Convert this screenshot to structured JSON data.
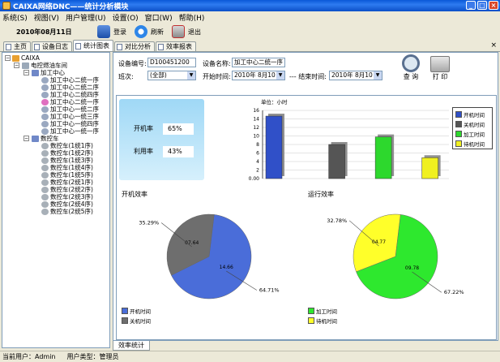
{
  "window": {
    "title": "CAIXA网络DNC——统计分析模块"
  },
  "menu": [
    "系统(S)",
    "视图(V)",
    "用户管理(U)",
    "设置(O)",
    "窗口(W)",
    "帮助(H)"
  ],
  "toolbar": {
    "date": "2010年08月11日",
    "login": "登录",
    "refresh": "刷新",
    "exit": "退出"
  },
  "tabs": [
    "主页",
    "设备日志",
    "统计图表",
    "对比分析",
    "效率报表"
  ],
  "tree": {
    "root": "CAIXA",
    "workshop": "电控燃油车间",
    "groups": [
      {
        "label": "加工中心",
        "items": [
          "加工中心二统一序",
          "加工中心二统二序",
          "加工中心二统四序",
          "加工中心二统一序",
          "加工中心一统二序",
          "加工中心一统三序",
          "加工中心一统四序",
          "加工中心一统一序"
        ]
      },
      {
        "label": "数控车",
        "items": [
          "数控车(1统1序)",
          "数控车(1统2序)",
          "数控车(1统3序)",
          "数控车(1统4序)",
          "数控车(1统5序)",
          "数控车(2统1序)",
          "数控车(2统2序)",
          "数控车(2统3序)",
          "数控车(2统4序)",
          "数控车(2统5序)"
        ]
      }
    ]
  },
  "form": {
    "device_no_label": "设备编号:",
    "device_no": "D100451200",
    "device_name_label": "设备名称:",
    "device_name": "加工中心二统一序",
    "shift_label": "班次:",
    "shift": "(全部)",
    "start_label": "开始时间:",
    "start": "2010年 8月10日",
    "end_label": "--- 结束时间:",
    "end": "2010年 8月10日",
    "query": "查 询",
    "print": "打 印"
  },
  "kpi": {
    "run_rate_label": "开机率",
    "run_rate": "65%",
    "use_rate_label": "利用率",
    "use_rate": "43%"
  },
  "bottom_tab": "效率统计",
  "status": {
    "user_label": "当前用户：",
    "user": "Admin",
    "type_label": "用户类型：",
    "type": "管理员"
  },
  "chart_data": [
    {
      "type": "bar",
      "title": "",
      "ylabel": "单位：小时",
      "ylim": [
        0,
        16
      ],
      "yticks": [
        "0.00",
        "2",
        "4",
        "6",
        "8",
        "10",
        "12",
        "14",
        "16"
      ],
      "categories": [
        "开机时间",
        "关机时间",
        "加工时间",
        "待机时间"
      ],
      "values": [
        14.66,
        8.0,
        9.78,
        4.9
      ],
      "colors": [
        "#3050C8",
        "#555555",
        "#2DD82D",
        "#F0F020"
      ],
      "legend": [
        "开机时间",
        "关机时间",
        "加工时间",
        "待机时间"
      ],
      "legend_position": "right"
    },
    {
      "type": "pie",
      "title": "开机效率",
      "slices": [
        {
          "name": "开机时间",
          "value": 14.66,
          "pct": "64.71%",
          "color": "#4A6DD9"
        },
        {
          "name": "关机时间",
          "value": 7.64,
          "pct": "35.29%",
          "color": "#6E6E6E"
        }
      ],
      "labels": {
        "a": "14.66",
        "b": "07.64"
      }
    },
    {
      "type": "pie",
      "title": "运行效率",
      "slices": [
        {
          "name": "加工时间",
          "value": 9.78,
          "pct": "67.22%",
          "color": "#2EE82E"
        },
        {
          "name": "待机时间",
          "value": 4.77,
          "pct": "32.78%",
          "color": "#FFFF2A"
        }
      ],
      "labels": {
        "a": "09.78",
        "b": "04.77"
      }
    }
  ]
}
